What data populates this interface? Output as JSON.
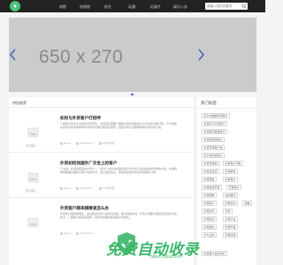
{
  "header": {
    "nav": [
      "电影",
      "电视剧",
      "综艺",
      "动漫",
      "纪录片",
      "娱乐八卦"
    ],
    "search_placeholder": "请输入您的关键词"
  },
  "slider": {
    "placeholder_text": "650 x 270"
  },
  "main": {
    "section_title": "特别推荐",
    "posts": [
      {
        "title": "如何与外贸客户打招呼",
        "desc": "了解客户的企业文化和背景同时，外贸员还需要了解客户所在地区的礼仪文化和沟通习惯，不同地区在商务交往中的称呼和问候方式都可能存在差异，因此外贸人员要尊重客户的当地习俗。",
        "author": "admin",
        "date": "2019-03-12",
        "views": "179次浏览",
        "thumb_caption": "暂无图片"
      },
      {
        "title": "外贸如何找国外广交会上的客户",
        "desc": "广交会，外贸的首选的方式之一，通过广交会寻找国外客户对外贸人来说是非常有效的方法，在展会期间能面对面地与客户沟通交流，建立信任关系，更容易促成合作并获得更多订单。",
        "author": "admin",
        "date": "2019-03-12",
        "views": "172次浏览",
        "thumb_caption": "暂无图片"
      },
      {
        "title": "外贸客户越来越难谈怎么办",
        "desc": "外贸客户越来越难谈，这是很多外贸人的共同感受。面对这种情况，外贸人需要不断提高自身的专业能力，了解客户的真实需求，用专业的服务赢得客户的信任。",
        "author": "admin",
        "date": "2019-03-12",
        "views": "",
        "thumb_caption": ""
      }
    ]
  },
  "sidebar": {
    "title": "热门标签",
    "tags": [
      "怎么去做做外贸客户",
      "外贸怎么开发客户",
      "外贸客户跟进技巧",
      "外贸如何找客户",
      "外贸开发客户信",
      "怎么找外贸客户",
      "外贸开发信",
      "外贸客户开发",
      "外贸业务员",
      "外贸邮件",
      "外贸展会",
      "外贸客户",
      "外贸电话开发",
      "开发客户",
      "外贸跟单",
      "谈判技巧",
      "外贸客户",
      "外贸谈判",
      "询盘",
      "外贸新手",
      "外贸",
      "外贸知识",
      "外贸平台",
      "外贸报价",
      "外贸开发",
      "什么业务",
      "外贸采购",
      "外贸客户信息询价"
    ]
  },
  "watermark": {
    "text": "免费自动收录",
    "url": "https://ybss.com"
  },
  "colors": {
    "header_bg": "#232323",
    "accent": "#3bb66a",
    "slider_bg": "#cbcbcb",
    "dot_active": "#3a5bb5"
  }
}
